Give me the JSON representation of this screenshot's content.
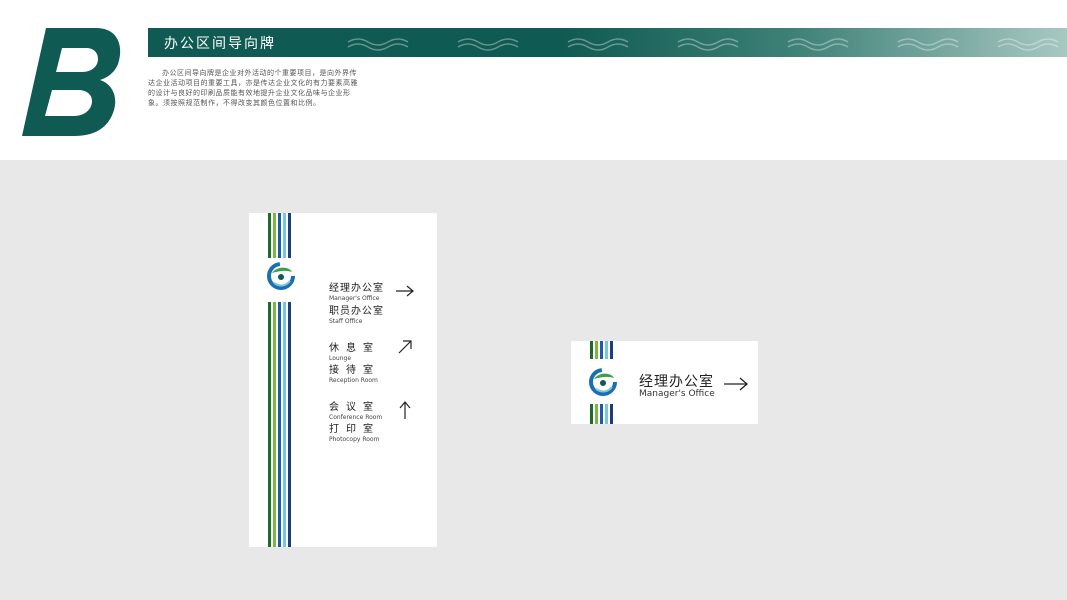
{
  "header": {
    "letter": "B",
    "title": "办公区间导向牌",
    "intro": "办公区间导向牌是企业对外活动的个重要项目，是向外界传达企业活动项目的重要工具，亦是传达企业文化的有力要素高雅的设计与良好的印刷品质能有效地提升企业文化品味与企业形象。须按照规范制作，不得改变其颜色位置和比例。"
  },
  "colors": {
    "brand_green": "#0f5a52",
    "stripe_colors": [
      "#1d6a2e",
      "#7fb640",
      "#1d5aa8",
      "#79c8d8",
      "#1a3f7a"
    ]
  },
  "tall_sign": {
    "entries": [
      {
        "cn": "经理办公室",
        "en": "Manager's Office"
      },
      {
        "cn": "职员办公室",
        "en": "Staff Office"
      },
      {
        "cn": "休息室",
        "en": "Lounge"
      },
      {
        "cn": "接待室",
        "en": "Reception Room"
      },
      {
        "cn": "会议室",
        "en": "Conference Room"
      },
      {
        "cn": "打印室",
        "en": "Photocopy Room"
      }
    ],
    "arrows": [
      "arrow-right-icon",
      "arrow-up-right-icon",
      "arrow-up-icon"
    ]
  },
  "wide_sign": {
    "cn": "经理办公室",
    "en": "Manager's Office",
    "arrow": "arrow-right-icon"
  }
}
